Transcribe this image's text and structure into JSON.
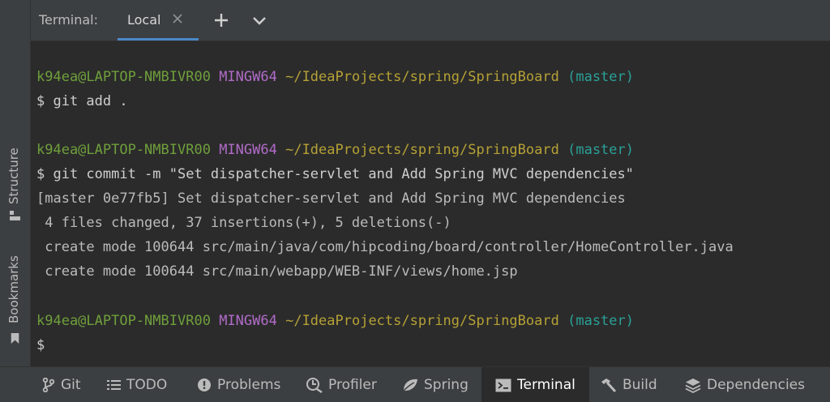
{
  "header": {
    "title": "Terminal:",
    "tabs": [
      {
        "label": "Local",
        "icon": "close-icon"
      }
    ],
    "actions": [
      {
        "name": "new-tab",
        "icon": "plus-icon"
      },
      {
        "name": "tab-options",
        "icon": "chevron-down-icon"
      }
    ]
  },
  "side_tabs": [
    {
      "label": "Structure",
      "icon": "structure-icon"
    },
    {
      "label": "Bookmarks",
      "icon": "bookmark-icon"
    }
  ],
  "terminal": {
    "prompt1": {
      "user": "k94ea@LAPTOP-NMBIVR00",
      "system": "MINGW64",
      "path": "~/IdeaProjects/spring/SpringBoard",
      "branch": "(master)"
    },
    "cmd1": "$ git add .",
    "prompt2": {
      "user": "k94ea@LAPTOP-NMBIVR00",
      "system": "MINGW64",
      "path": "~/IdeaProjects/spring/SpringBoard",
      "branch": "(master)"
    },
    "cmd2": "$ git commit -m \"Set dispatcher-servlet and Add Spring MVC dependencies\"",
    "output": [
      "[master 0e77fb5] Set dispatcher-servlet and Add Spring MVC dependencies",
      " 4 files changed, 37 insertions(+), 5 deletions(-)",
      " create mode 100644 src/main/java/com/hipcoding/board/controller/HomeController.java",
      " create mode 100644 src/main/webapp/WEB-INF/views/home.jsp"
    ],
    "prompt3": {
      "user": "k94ea@LAPTOP-NMBIVR00",
      "system": "MINGW64",
      "path": "~/IdeaProjects/spring/SpringBoard",
      "branch": "(master)"
    },
    "cmd3": "$"
  },
  "toolbar": {
    "items": [
      {
        "label": "Git",
        "icon": "git-branch-icon"
      },
      {
        "label": "TODO",
        "icon": "list-icon"
      },
      {
        "label": "Problems",
        "icon": "alert-circle-icon"
      },
      {
        "label": "Profiler",
        "icon": "profiler-icon"
      },
      {
        "label": "Spring",
        "icon": "spring-leaf-icon"
      },
      {
        "label": "Terminal",
        "icon": "terminal-icon",
        "active": true
      },
      {
        "label": "Build",
        "icon": "hammer-icon"
      },
      {
        "label": "Dependencies",
        "icon": "layers-icon"
      }
    ]
  },
  "colors": {
    "background": "#2b2b2b",
    "panel": "#3c3f41",
    "accent": "#4a88c7",
    "user": "#6f9f3b",
    "system": "#b06bc8",
    "path": "#b5a135",
    "branch": "#2aa198"
  }
}
